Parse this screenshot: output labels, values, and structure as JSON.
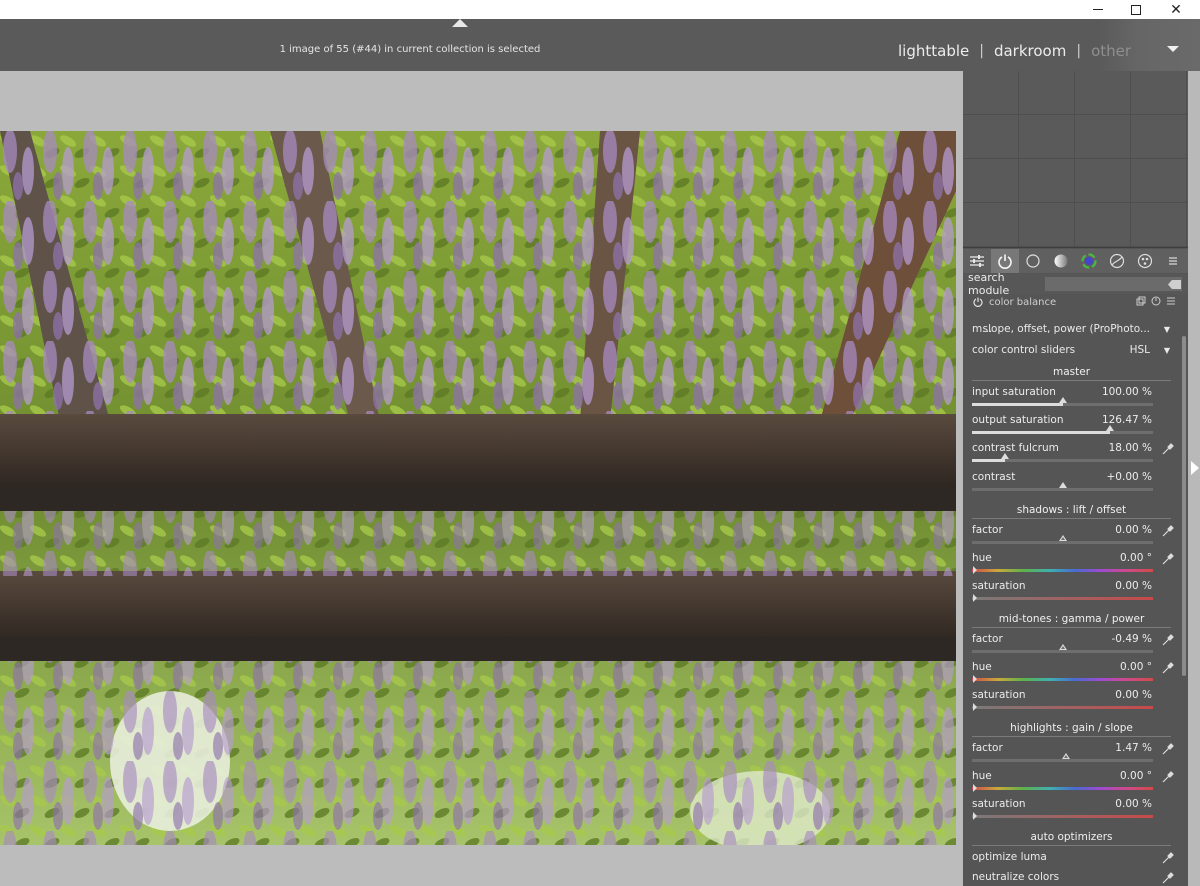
{
  "os_controls": {
    "minimize": "–",
    "maximize": "□",
    "close": "✕"
  },
  "header": {
    "selection_status": "1 image of 55 (#44) in current collection is selected",
    "views": [
      {
        "label": "lighttable"
      },
      {
        "label": "darkroom"
      },
      {
        "label": "other"
      }
    ],
    "separator": "|"
  },
  "right_panel": {
    "group_tabs": [
      "quick-access-icon",
      "active-modules-icon",
      "base-group-icon",
      "tone-group-icon",
      "color-group-icon",
      "correct-group-icon",
      "effect-group-icon",
      "presets-menu-icon"
    ],
    "search": {
      "label": "search module",
      "value": ""
    },
    "module": {
      "title": "color balance",
      "mode_label": "m...",
      "mode_value": "slope, offset, power (ProPhoto...",
      "sliders_label": "color control sliders",
      "sliders_value": "HSL",
      "sections": {
        "master": "master",
        "shadows": "shadows : lift / offset",
        "midtones": "mid-tones : gamma / power",
        "highlights": "highlights : gain / slope",
        "auto": "auto optimizers"
      },
      "master": {
        "input_saturation": {
          "label": "input saturation",
          "value": "100.00 %",
          "level": 0.5
        },
        "output_saturation": {
          "label": "output saturation",
          "value": "126.47 %",
          "level": 0.76
        },
        "contrast_fulcrum": {
          "label": "contrast fulcrum",
          "value": "18.00 %",
          "level": 0.18
        },
        "contrast": {
          "label": "contrast",
          "value": "+0.00 %",
          "level": 0.5
        }
      },
      "shadows": {
        "factor": {
          "label": "factor",
          "value": "0.00 %",
          "level": 0.5
        },
        "hue": {
          "label": "hue",
          "value": "0.00 °"
        },
        "saturation": {
          "label": "saturation",
          "value": "0.00 %"
        }
      },
      "midtones": {
        "factor": {
          "label": "factor",
          "value": "-0.49 %",
          "level": 0.5
        },
        "hue": {
          "label": "hue",
          "value": "0.00 °"
        },
        "saturation": {
          "label": "saturation",
          "value": "0.00 %"
        }
      },
      "highlights": {
        "factor": {
          "label": "factor",
          "value": "1.47 %",
          "level": 0.52
        },
        "hue": {
          "label": "hue",
          "value": "0.00 °"
        },
        "saturation": {
          "label": "saturation",
          "value": "0.00 %"
        }
      },
      "optimizers": [
        "optimize luma",
        "neutralize colors"
      ]
    }
  },
  "colors": {
    "panel_bg": "#555555",
    "header_bg": "#5a5a5a",
    "canvas_bg": "#bcbcbc"
  }
}
